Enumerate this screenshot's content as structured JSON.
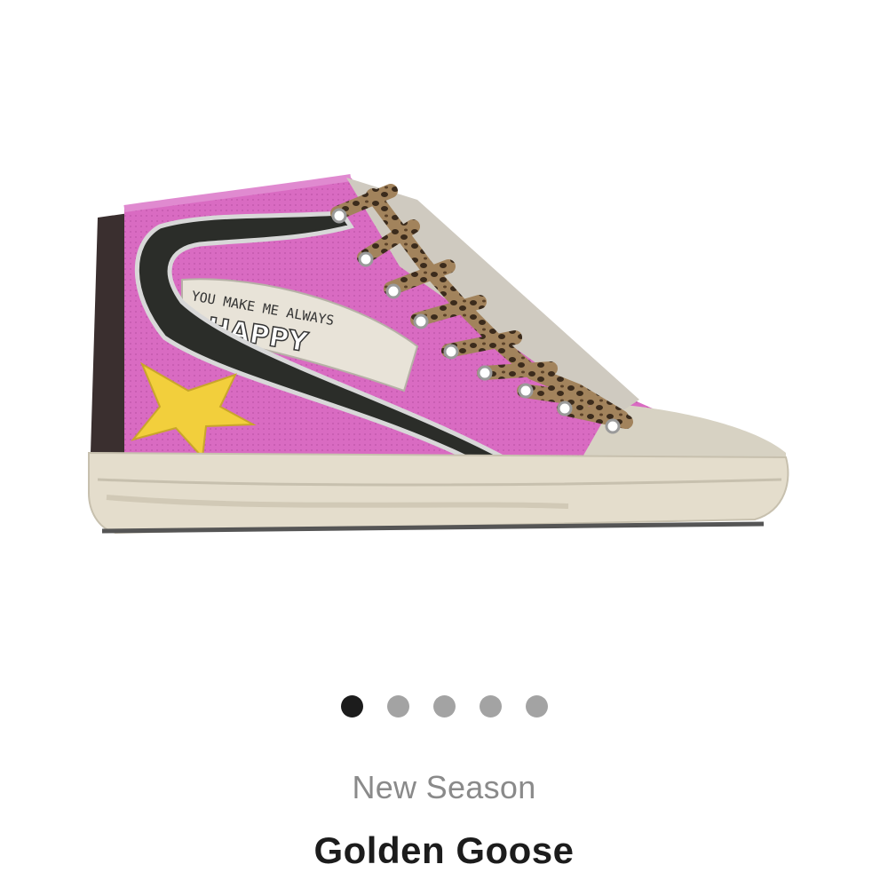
{
  "product": {
    "season": "New Season",
    "brand": "Golden Goose",
    "shoe_text": {
      "line1": "YOU MAKE ME ALWAYS",
      "word": "HAPPY"
    },
    "colors": {
      "upper": "#d96bc2",
      "upper_dark": "#b84ea0",
      "stripe": "#2b2d29",
      "star": "#f2cf3c",
      "sole": "#e4ddcc",
      "laces": "#7a5b3c"
    }
  },
  "carousel": {
    "total": 5,
    "active_index": 0
  }
}
